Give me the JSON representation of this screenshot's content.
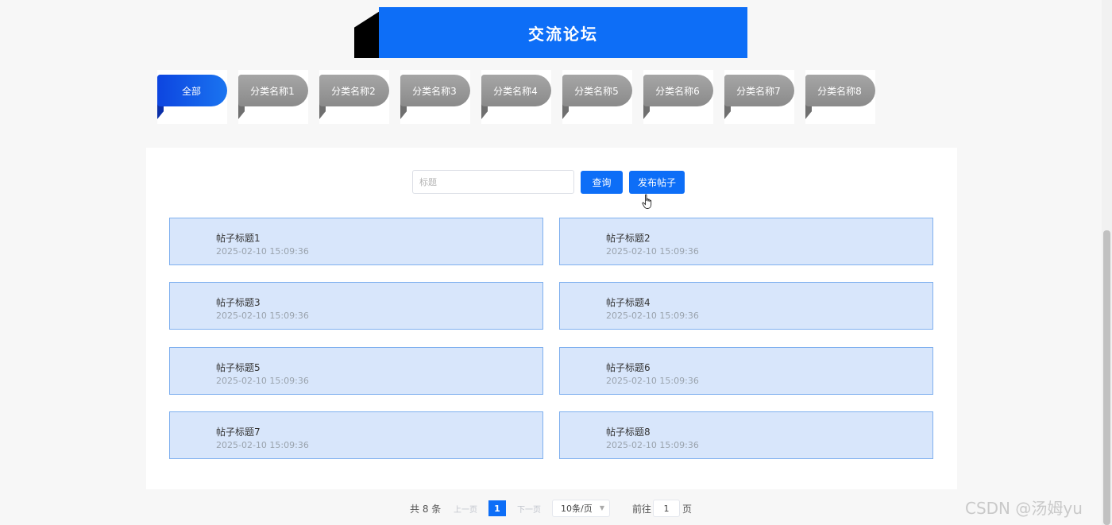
{
  "banner": {
    "title": "交流论坛"
  },
  "categories": [
    {
      "label": "全部",
      "active": true
    },
    {
      "label": "分类名称1",
      "active": false
    },
    {
      "label": "分类名称2",
      "active": false
    },
    {
      "label": "分类名称3",
      "active": false
    },
    {
      "label": "分类名称4",
      "active": false
    },
    {
      "label": "分类名称5",
      "active": false
    },
    {
      "label": "分类名称6",
      "active": false
    },
    {
      "label": "分类名称7",
      "active": false
    },
    {
      "label": "分类名称8",
      "active": false
    }
  ],
  "search": {
    "placeholder": "标题",
    "value": "",
    "query_label": "查询",
    "post_label": "发布帖子"
  },
  "posts": [
    {
      "title": "帖子标题1",
      "time": "2025-02-10 15:09:36"
    },
    {
      "title": "帖子标题2",
      "time": "2025-02-10 15:09:36"
    },
    {
      "title": "帖子标题3",
      "time": "2025-02-10 15:09:36"
    },
    {
      "title": "帖子标题4",
      "time": "2025-02-10 15:09:36"
    },
    {
      "title": "帖子标题5",
      "time": "2025-02-10 15:09:36"
    },
    {
      "title": "帖子标题6",
      "time": "2025-02-10 15:09:36"
    },
    {
      "title": "帖子标题7",
      "time": "2025-02-10 15:09:36"
    },
    {
      "title": "帖子标题8",
      "time": "2025-02-10 15:09:36"
    }
  ],
  "pagination": {
    "total_text": "共 8 条",
    "prev_label": "上一页",
    "current_page": "1",
    "next_label": "下一页",
    "page_size": "10条/页",
    "goto_label": "前往",
    "goto_value": "1",
    "page_unit": "页"
  },
  "watermark": "CSDN @汤姆yu",
  "colors": {
    "primary": "#0d6ef7",
    "card_bg": "#d8e6fb",
    "card_border": "#7fb0ef",
    "tab_gray": "#999999"
  }
}
